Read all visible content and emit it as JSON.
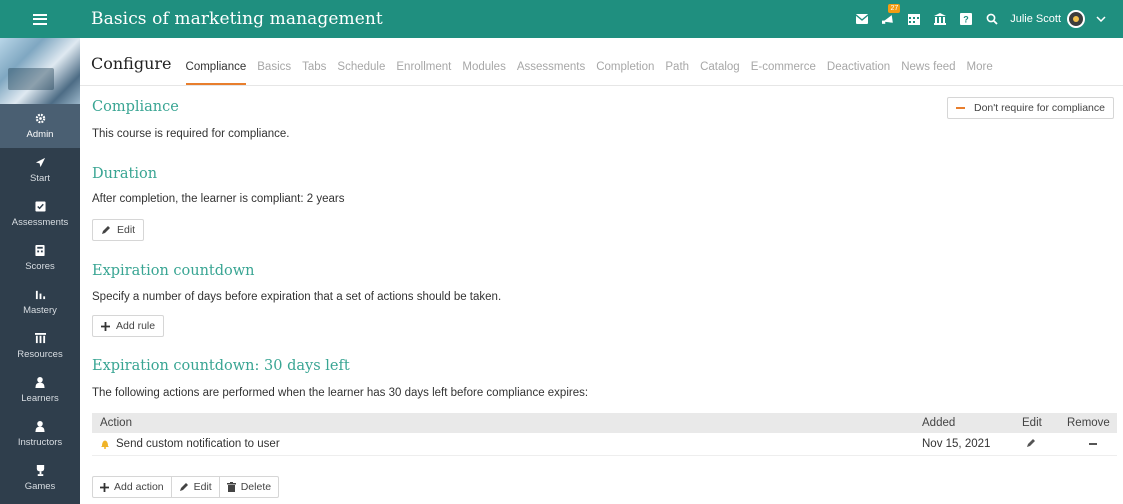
{
  "header": {
    "title": "Basics of marketing management",
    "notification_count": "27",
    "user_name": "Julie Scott"
  },
  "sidebar": {
    "items": [
      {
        "label": "Admin",
        "icon": "gear-icon"
      },
      {
        "label": "Start",
        "icon": "paper-plane-icon"
      },
      {
        "label": "Assessments",
        "icon": "check-square-icon"
      },
      {
        "label": "Scores",
        "icon": "calculator-icon"
      },
      {
        "label": "Mastery",
        "icon": "bar-chart-icon"
      },
      {
        "label": "Resources",
        "icon": "library-icon"
      },
      {
        "label": "Learners",
        "icon": "user-icon"
      },
      {
        "label": "Instructors",
        "icon": "user-icon"
      },
      {
        "label": "Games",
        "icon": "trophy-icon"
      }
    ]
  },
  "page": {
    "configure_label": "Configure",
    "tabs": [
      "Compliance",
      "Basics",
      "Tabs",
      "Schedule",
      "Enrollment",
      "Modules",
      "Assessments",
      "Completion",
      "Path",
      "Catalog",
      "E-commerce",
      "Deactivation",
      "News feed",
      "More"
    ]
  },
  "compliance": {
    "heading": "Compliance",
    "text": "This course is required for compliance.",
    "button": "Don't require for compliance"
  },
  "duration": {
    "heading": "Duration",
    "text": "After completion, the learner is compliant: 2 years",
    "edit_label": "Edit"
  },
  "expiration": {
    "heading": "Expiration countdown",
    "text": "Specify a number of days before expiration that a set of actions should be taken.",
    "add_rule_label": "Add rule"
  },
  "countdown": {
    "heading": "Expiration countdown: 30 days left",
    "text": "The following actions are performed when the learner has 30 days left before compliance expires:",
    "columns": {
      "action": "Action",
      "added": "Added",
      "edit": "Edit",
      "remove": "Remove"
    },
    "rows": [
      {
        "action": "Send custom notification to user",
        "added": "Nov 15, 2021"
      }
    ],
    "buttons": {
      "add_action": "Add action",
      "edit": "Edit",
      "delete": "Delete"
    }
  },
  "colors": {
    "brand": "#1f8f7f",
    "sidebar": "#2f3e4c",
    "accent": "#e87e2d",
    "heading": "#39a593"
  }
}
